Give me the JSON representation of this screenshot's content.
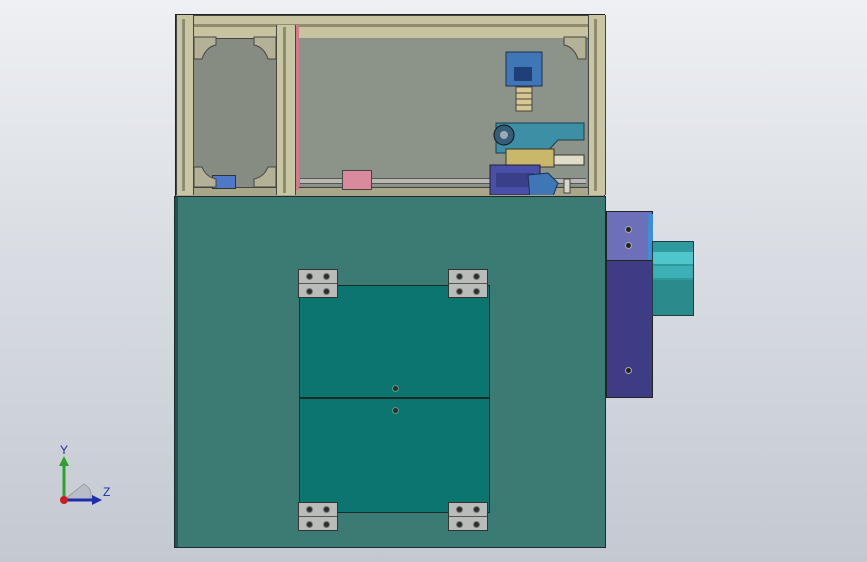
{
  "view": {
    "background_top": "#eef0f3",
    "background_bottom": "#c4c9d1"
  },
  "model": {
    "frame_color": "#c9c6a3",
    "cabinet_color": "#3c7a74",
    "door_color": "#0d7570",
    "motor_color": "#3d3c84",
    "cylinder_color": "#2e9a9d"
  },
  "triad": {
    "y_label": "Y",
    "z_label": "Z",
    "y_color": "#2fa12f",
    "z_color": "#1c2db0",
    "origin_color": "#c81e1e"
  }
}
